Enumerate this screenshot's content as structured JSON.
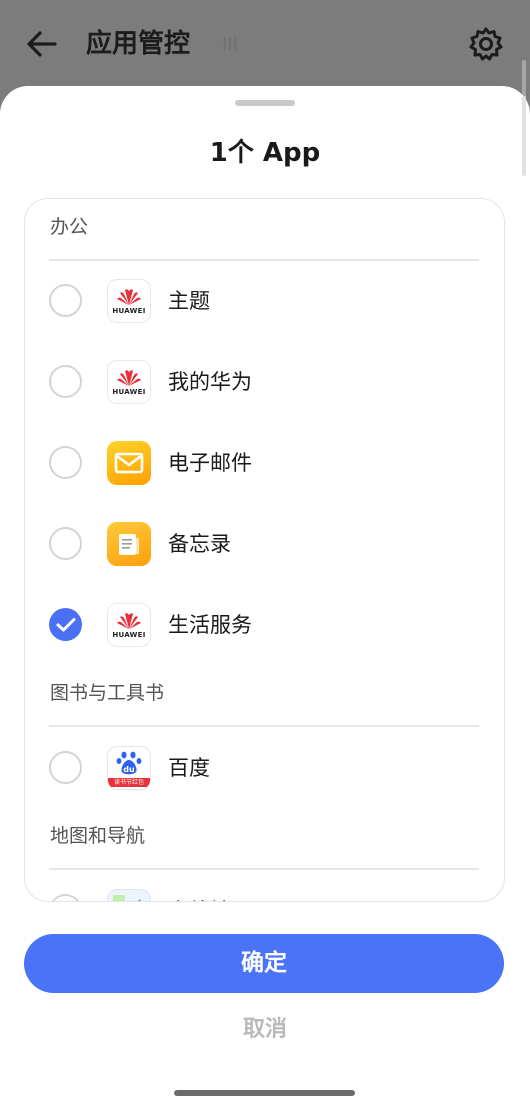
{
  "header": {
    "title": "应用管控",
    "subtitle": "III",
    "back_icon": "arrow-left-icon",
    "settings_icon": "gear-icon"
  },
  "sheet": {
    "title": "1个 App"
  },
  "groups": [
    {
      "header": "办公",
      "apps": [
        {
          "name": "主题",
          "icon": "huawei-icon",
          "checked": false
        },
        {
          "name": "我的华为",
          "icon": "huawei-icon",
          "checked": false
        },
        {
          "name": "电子邮件",
          "icon": "mail-icon",
          "checked": false
        },
        {
          "name": "备忘录",
          "icon": "memo-icon",
          "checked": false
        },
        {
          "name": "生活服务",
          "icon": "huawei-icon",
          "checked": true
        }
      ]
    },
    {
      "header": "图书与工具书",
      "apps": [
        {
          "name": "百度",
          "icon": "baidu-icon",
          "checked": false
        }
      ]
    },
    {
      "header": "地图和导航",
      "apps": [
        {
          "name": "高德地图",
          "icon": "map-icon",
          "checked": false
        }
      ]
    }
  ],
  "icon_text": {
    "huawei": "HUAWEI",
    "baidu_main": "du",
    "baidu_strip": "读书节红包"
  },
  "buttons": {
    "confirm": "确定",
    "cancel": "取消"
  },
  "colors": {
    "accent": "#4a73f7",
    "scrim": "#7f7f7f",
    "huawei_red": "#e8313b"
  }
}
